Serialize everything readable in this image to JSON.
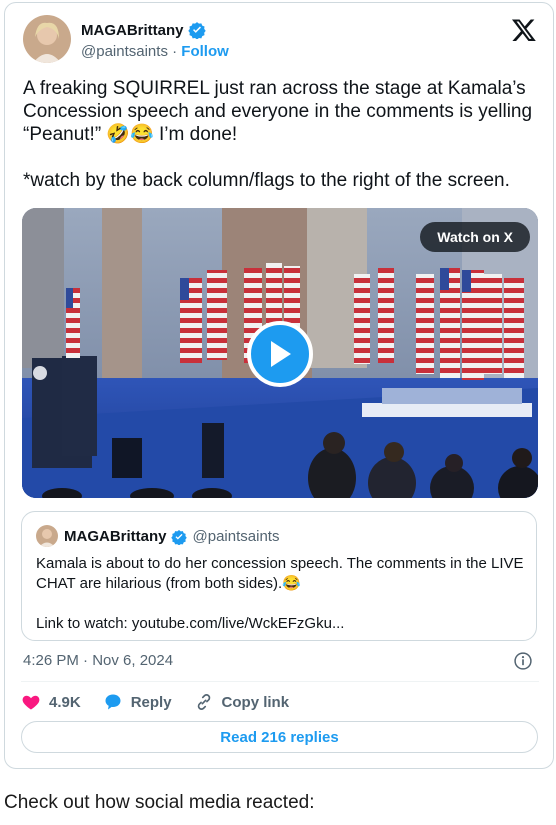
{
  "author": {
    "name": "MAGABrittany",
    "handle": "@paintsaints",
    "separator": "·",
    "follow_label": "Follow",
    "verified_icon": "verified-badge-icon"
  },
  "tweet": {
    "text": "A freaking SQUIRREL just ran across the stage at Kamala’s Concession speech and everyone in the comments is yelling “Peanut!” 🤣😂 I’m done!\n\n*watch by the back column/flags to the right of the screen."
  },
  "video": {
    "watch_label": "Watch on X",
    "play_icon": "play-icon"
  },
  "quote": {
    "name": "MAGABrittany",
    "handle": "@paintsaints",
    "text": "Kamala is about to do her concession speech. The comments in the LIVE CHAT are hilarious (from both sides).😂\n\nLink to watch: youtube.com/live/WckEFzGku..."
  },
  "meta": {
    "timestamp": "4:26 PM · Nov 6, 2024"
  },
  "actions": {
    "likes": "4.9K",
    "reply_label": "Reply",
    "copy_label": "Copy link"
  },
  "read_replies_label": "Read 216 replies",
  "caption": "Check out how social media reacted:",
  "colors": {
    "accent": "#1d9bf0",
    "like": "#f91880",
    "muted": "#536471",
    "border": "#cfd9de"
  }
}
